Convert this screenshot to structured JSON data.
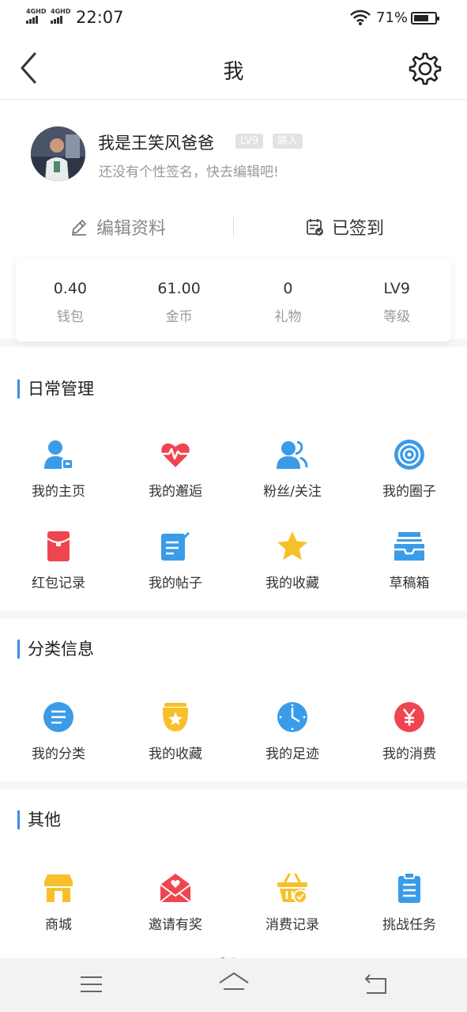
{
  "status_bar": {
    "sim1": "4GHD",
    "sim2": "4GHD",
    "time": "22:07",
    "battery": "71%",
    "battery_level": 0.71
  },
  "nav": {
    "title": "我",
    "back_icon": "chevron-left-icon",
    "settings_icon": "gear-icon"
  },
  "profile": {
    "name": "我是王笑风爸爸",
    "level_badge": "LV9",
    "rank_badge": "路人",
    "signature": "还没有个性签名，快去编辑吧!",
    "edit_label": "编辑资料",
    "signed_label": "已签到"
  },
  "stats": [
    {
      "value": "0.40",
      "label": "钱包"
    },
    {
      "value": "61.00",
      "label": "金币"
    },
    {
      "value": "0",
      "label": "礼物"
    },
    {
      "value": "LV9",
      "label": "等级"
    }
  ],
  "sections": {
    "daily": {
      "title": "日常管理",
      "items": [
        {
          "label": "我的主页",
          "icon": "user-card-icon"
        },
        {
          "label": "我的邂逅",
          "icon": "heartbeat-icon"
        },
        {
          "label": "粉丝/关注",
          "icon": "users-icon"
        },
        {
          "label": "我的圈子",
          "icon": "target-icon"
        },
        {
          "label": "红包记录",
          "icon": "red-envelope-icon"
        },
        {
          "label": "我的帖子",
          "icon": "post-edit-icon"
        },
        {
          "label": "我的收藏",
          "icon": "star-icon"
        },
        {
          "label": "草稿箱",
          "icon": "inbox-icon"
        }
      ]
    },
    "category": {
      "title": "分类信息",
      "items": [
        {
          "label": "我的分类",
          "icon": "list-icon"
        },
        {
          "label": "我的收藏",
          "icon": "star-box-icon"
        },
        {
          "label": "我的足迹",
          "icon": "clock-icon"
        },
        {
          "label": "我的消费",
          "icon": "yen-icon"
        }
      ]
    },
    "other": {
      "title": "其他",
      "items": [
        {
          "label": "商城",
          "icon": "store-icon"
        },
        {
          "label": "邀请有奖",
          "icon": "invite-envelope-icon"
        },
        {
          "label": "消费记录",
          "icon": "basket-icon"
        },
        {
          "label": "挑战任务",
          "icon": "clipboard-icon"
        }
      ]
    }
  },
  "colors": {
    "accent": "#3d8ee0",
    "blue": "#3a9be8",
    "red": "#f0454e",
    "yellow": "#f7c02a"
  },
  "system_nav": [
    "menu-icon",
    "home-icon",
    "back-icon"
  ]
}
